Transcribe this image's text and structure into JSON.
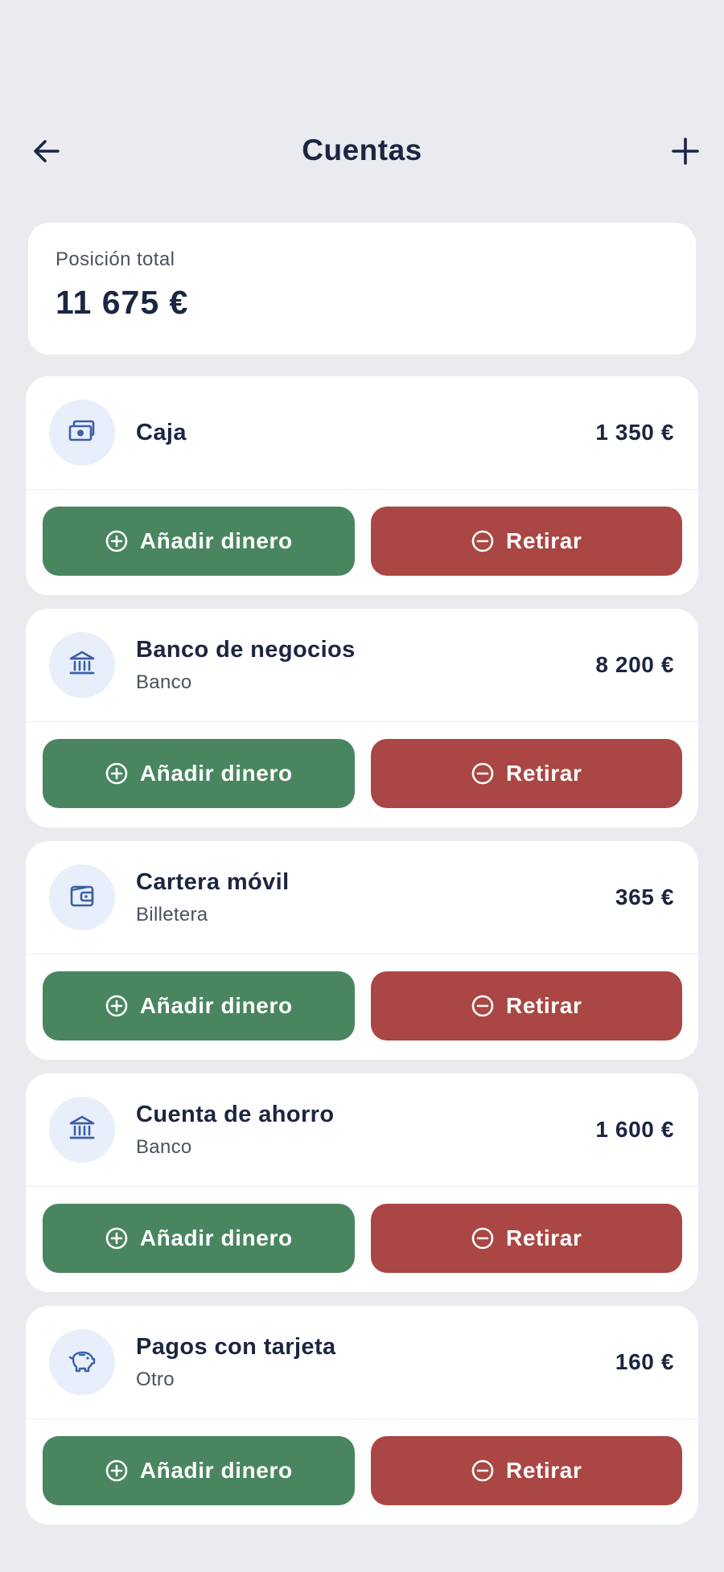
{
  "header": {
    "title": "Cuentas",
    "back_icon": "arrow-left-icon",
    "add_icon": "plus-icon"
  },
  "total": {
    "label": "Posición total",
    "amount": "11 675 €"
  },
  "colors": {
    "background": "#e9ebef",
    "card": "#ffffff",
    "add_button": "#498660",
    "withdraw_button": "#aa4643",
    "icon_bg": "#e8eefa",
    "icon": "#3b5fa8",
    "text": "#1c2541"
  },
  "buttons": {
    "add_label": "Añadir dinero",
    "withdraw_label": "Retirar"
  },
  "accounts": [
    {
      "name": "Caja",
      "type": "",
      "balance": "1 350 €",
      "icon": "cash-icon"
    },
    {
      "name": "Banco de negocios",
      "type": "Banco",
      "balance": "8 200 €",
      "icon": "bank-icon"
    },
    {
      "name": "Cartera móvil",
      "type": "Billetera",
      "balance": "365 €",
      "icon": "wallet-icon"
    },
    {
      "name": "Cuenta de ahorro",
      "type": "Banco",
      "balance": "1 600 €",
      "icon": "bank-icon"
    },
    {
      "name": "Pagos con tarjeta",
      "type": "Otro",
      "balance": "160 €",
      "icon": "piggy-bank-icon"
    }
  ]
}
